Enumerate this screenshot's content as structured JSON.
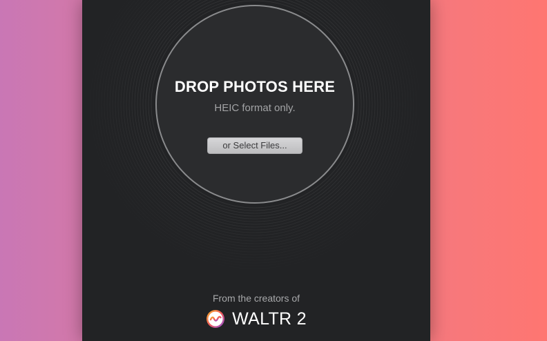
{
  "drop_zone": {
    "title": "DROP PHOTOS HERE",
    "subtitle": "HEIC format only.",
    "select_button_label": "or Select Files..."
  },
  "footer": {
    "caption": "From the creators of",
    "brand_name": "WALTR 2",
    "brand_logo_icon": "waltr-wave-logo-icon"
  },
  "colors": {
    "window_background": "#222325",
    "drop_zone_fill": "#2b2c2e",
    "drop_zone_border": "#8a8b8d",
    "background_gradient_left": "#c977b5",
    "background_gradient_right": "#fe7671",
    "logo_ring_start": "#f7b52c",
    "logo_ring_end": "#8b4fe0"
  }
}
